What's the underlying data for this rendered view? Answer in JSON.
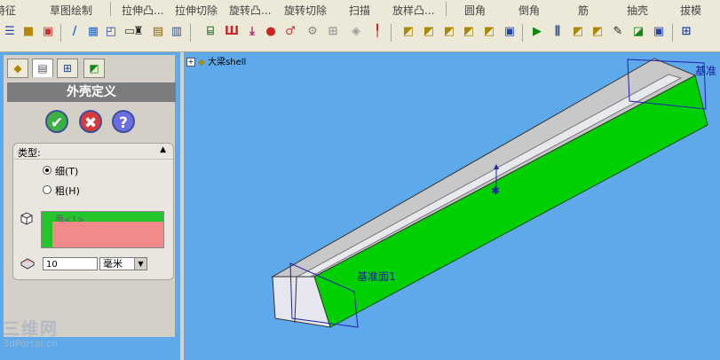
{
  "menu": {
    "items": [
      "特征",
      "草图绘制",
      "拉伸凸...",
      "拉伸切除",
      "旋转凸...",
      "旋转切除",
      "扫描",
      "放样凸...",
      "圆角",
      "倒角",
      "筋",
      "抽壳",
      "拔模"
    ]
  },
  "panel": {
    "title": "外壳定义",
    "ok": "✔",
    "cancel": "✖",
    "help": "?",
    "type_group": {
      "label": "类型:",
      "collapse": "▲",
      "option_thin": "细(T)",
      "option_thick": "粗(H)"
    },
    "face_item": "面<1>",
    "thickness_value": "10",
    "unit": "毫米",
    "unit_arrow": "▼"
  },
  "tree": {
    "expand": "+",
    "part_name": "大梁shell"
  },
  "viewport": {
    "plane_label_1": "基准面1",
    "plane_label_2": "基准"
  },
  "watermark": {
    "line1": "三维网",
    "line2": "3dPortal.cn"
  },
  "colors": {
    "viewport_bg": "#5da9ea",
    "beam_face_green": "#00d000",
    "beam_top_gray": "#c8c8c8",
    "plane_outline": "#2222aa",
    "face_list_pink": "#f28a8a"
  }
}
